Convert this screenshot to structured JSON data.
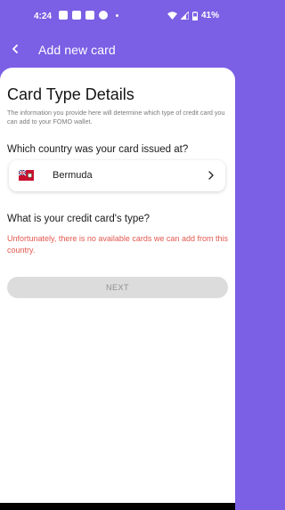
{
  "status_bar": {
    "time": "4:24",
    "battery": "41%",
    "icons": [
      "discord-icon",
      "discord-icon",
      "cc-icon",
      "facebook-icon",
      "dot-icon",
      "wifi-icon",
      "signal-icon",
      "battery-icon"
    ]
  },
  "app_bar": {
    "title": "Add new card",
    "back_icon": "chevron-left-icon"
  },
  "content": {
    "title": "Card Type Details",
    "description": "The information you provide here will determine which type of credit card you can add to your FOMO wallet.",
    "country_question": "Which country was your card issued at?",
    "country": {
      "name": "Bermuda",
      "flag": "bermuda-flag-icon",
      "chevron": "chevron-right-icon"
    },
    "type_question": "What is your credit card's type?",
    "error_message": "Unfortunately, there is no available cards we can add from this country.",
    "next_label": "NEXT"
  },
  "colors": {
    "accent": "#7b5fe4",
    "error": "#e2584f",
    "disabled_bg": "#dcdcdc",
    "disabled_text": "#8f8f8f"
  }
}
